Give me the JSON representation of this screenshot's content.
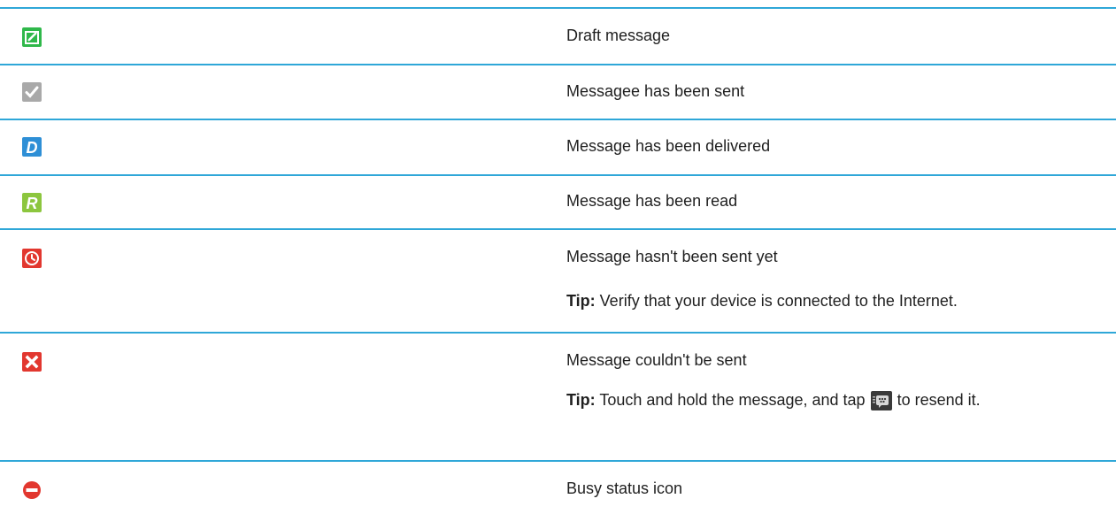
{
  "rows": [
    {
      "icon": "draft-icon",
      "label": "Draft message"
    },
    {
      "icon": "sent-check-icon",
      "label": "Messagee has been sent"
    },
    {
      "icon": "delivered-d-icon",
      "label": "Message has been delivered",
      "letter": "D"
    },
    {
      "icon": "read-r-icon",
      "label": "Message has been read",
      "letter": "R"
    },
    {
      "icon": "clock-pending-icon",
      "label": "Message hasn't been sent yet",
      "tip_prefix": "Tip:",
      "tip_text": " Verify that your device is connected to the Internet."
    },
    {
      "icon": "failed-x-icon",
      "label": "Message couldn't be sent",
      "tip_prefix": "Tip:",
      "tip_text_before": " Touch and hold the message, and tap",
      "tip_text_after": "to resend it.",
      "tip_icon": "bbm-chat-icon"
    },
    {
      "icon": "busy-status-icon",
      "label": "Busy status icon"
    }
  ],
  "colors": {
    "rule": "#2fa7d8",
    "draft": "#2fb84a",
    "sent": "#a9a9a9",
    "delivered": "#2e8fd6",
    "read": "#8cc63e",
    "pending": "#e2372f",
    "failed": "#e2372f",
    "busy": "#e2372f"
  }
}
